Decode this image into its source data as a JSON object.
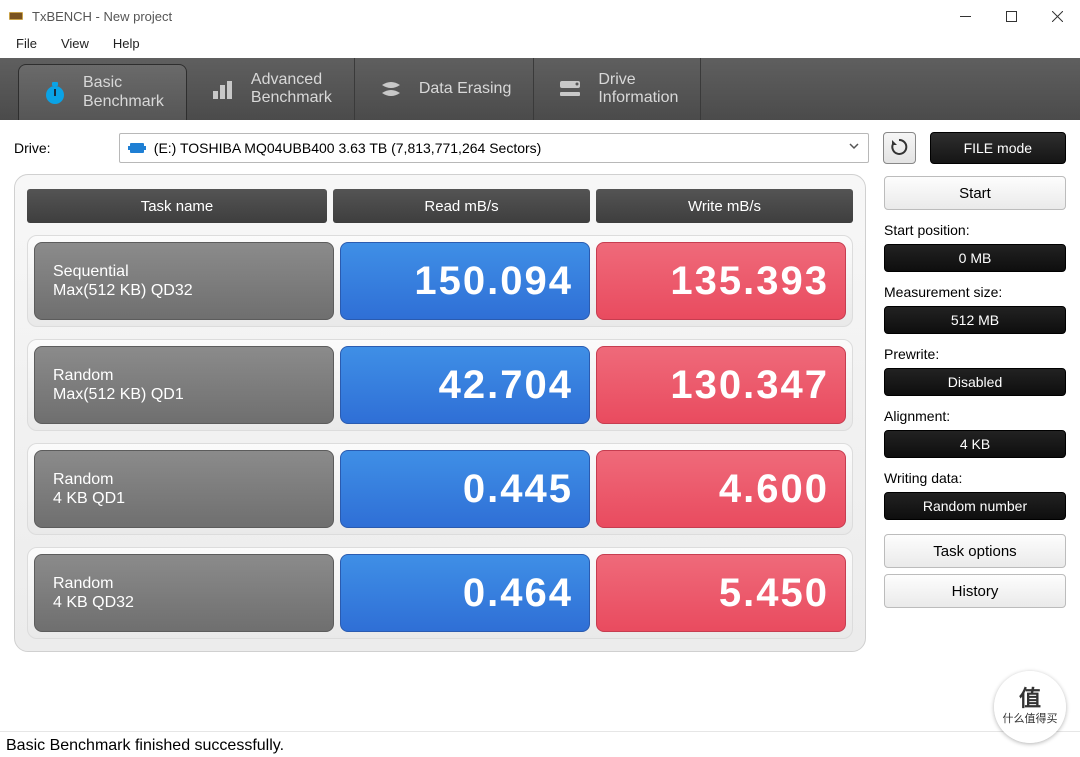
{
  "window": {
    "title": "TxBENCH - New project"
  },
  "menu": {
    "file": "File",
    "view": "View",
    "help": "Help"
  },
  "tabs": {
    "basic": {
      "line1": "Basic",
      "line2": "Benchmark"
    },
    "advanced": {
      "line1": "Advanced",
      "line2": "Benchmark"
    },
    "erase": {
      "line1": "Data Erasing"
    },
    "drive": {
      "line1": "Drive",
      "line2": "Information"
    }
  },
  "driveRow": {
    "label": "Drive:",
    "selected": "(E:) TOSHIBA MQ04UBB400  3.63 TB (7,813,771,264 Sectors)",
    "modeBtn": "FILE mode"
  },
  "headers": {
    "task": "Task name",
    "read": "Read mB/s",
    "write": "Write mB/s"
  },
  "rows": [
    {
      "taskLine1": "Sequential",
      "taskLine2": "Max(512 KB) QD32",
      "read": "150.094",
      "write": "135.393"
    },
    {
      "taskLine1": "Random",
      "taskLine2": "Max(512 KB) QD1",
      "read": "42.704",
      "write": "130.347"
    },
    {
      "taskLine1": "Random",
      "taskLine2": "4 KB QD1",
      "read": "0.445",
      "write": "4.600"
    },
    {
      "taskLine1": "Random",
      "taskLine2": "4 KB QD32",
      "read": "0.464",
      "write": "5.450"
    }
  ],
  "side": {
    "start": "Start",
    "startPosLabel": "Start position:",
    "startPosVal": "0 MB",
    "measLabel": "Measurement size:",
    "measVal": "512 MB",
    "prewriteLabel": "Prewrite:",
    "prewriteVal": "Disabled",
    "alignLabel": "Alignment:",
    "alignVal": "4 KB",
    "wdataLabel": "Writing data:",
    "wdataVal": "Random number",
    "taskOptions": "Task options",
    "history": "History"
  },
  "status": "Basic Benchmark finished successfully.",
  "watermark": {
    "top": "值",
    "bot": "什么值得买"
  }
}
